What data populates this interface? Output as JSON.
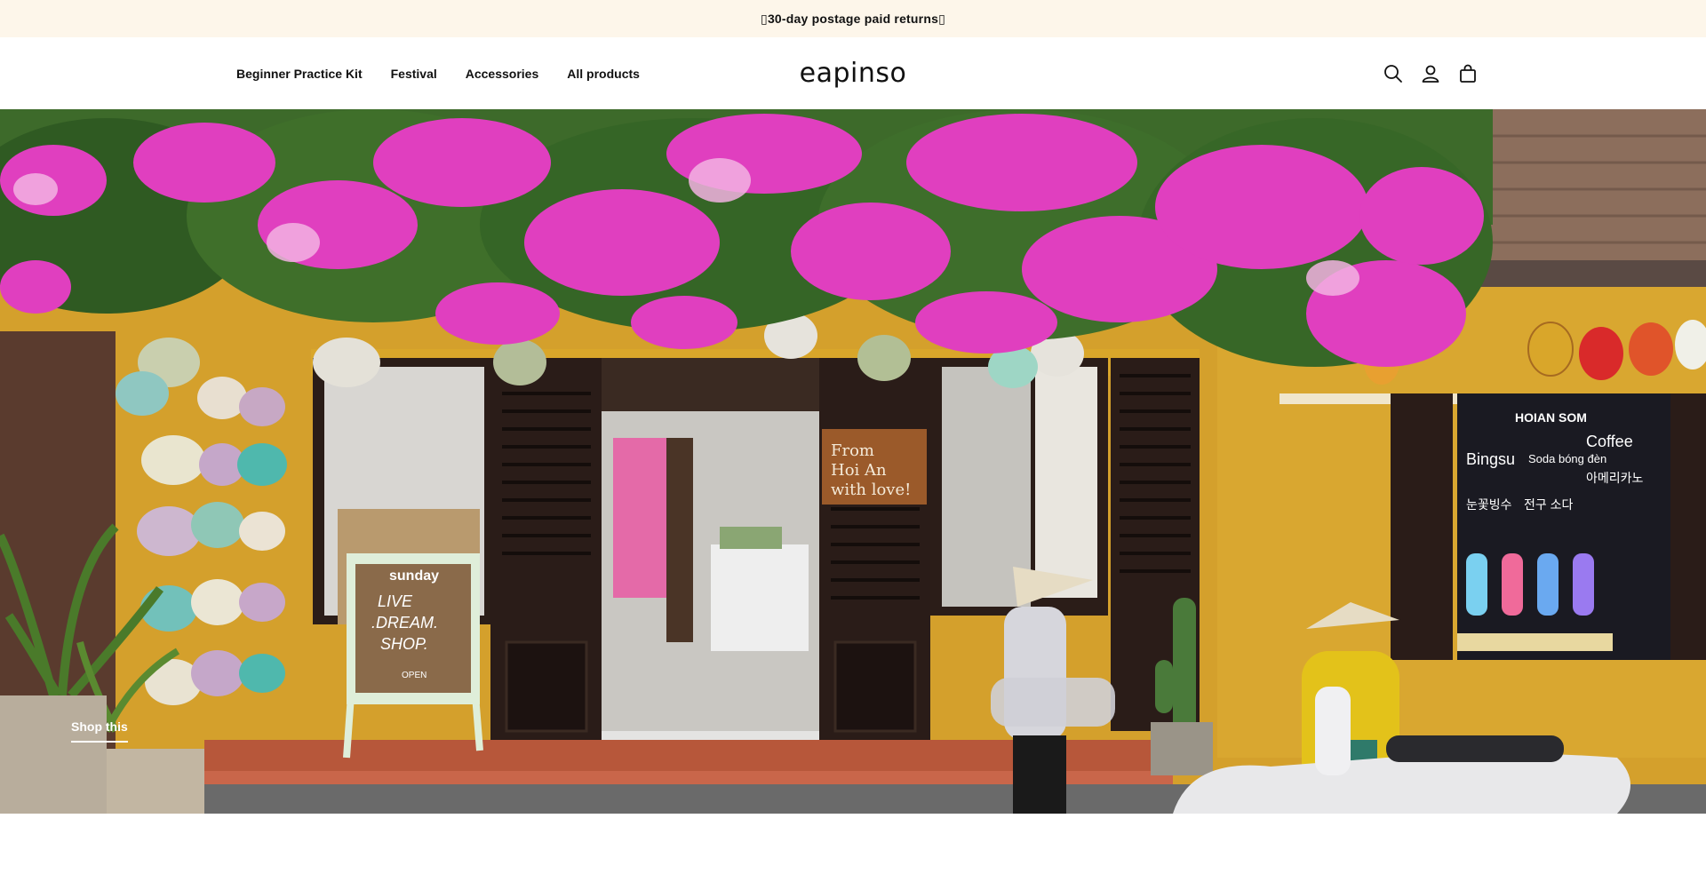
{
  "announcement": {
    "text": "30-day postage paid returns",
    "prefix_glyph": "▯",
    "suffix_glyph": "▯"
  },
  "header": {
    "nav": [
      {
        "label": "Beginner Practice Kit"
      },
      {
        "label": "Festival"
      },
      {
        "label": "Accessories"
      },
      {
        "label": "All products"
      }
    ],
    "logo": "eapinso",
    "icons": [
      "search-icon",
      "account-icon",
      "cart-icon"
    ]
  },
  "hero": {
    "cta_label": "Shop this",
    "store_sign": [
      "From",
      "Hoi An",
      "with love!"
    ],
    "board_sign": {
      "brand": "sunday",
      "lines": [
        "LIVE",
        ".DREAM.",
        "SHOP."
      ],
      "open": "OPEN"
    },
    "cafe_sign": {
      "title": "HOIAN SOM",
      "items": [
        "Coffee",
        "Bingsu",
        "Soda\nbóng đèn",
        "아메리카노",
        "눈꽃빙수",
        "전구 소다"
      ]
    }
  },
  "colors": {
    "announcement_bg": "#fdf6ea",
    "wall_yellow": "#d9a62a",
    "bougainvillea": "#e03fbf",
    "door_dark": "#2a1c18"
  }
}
